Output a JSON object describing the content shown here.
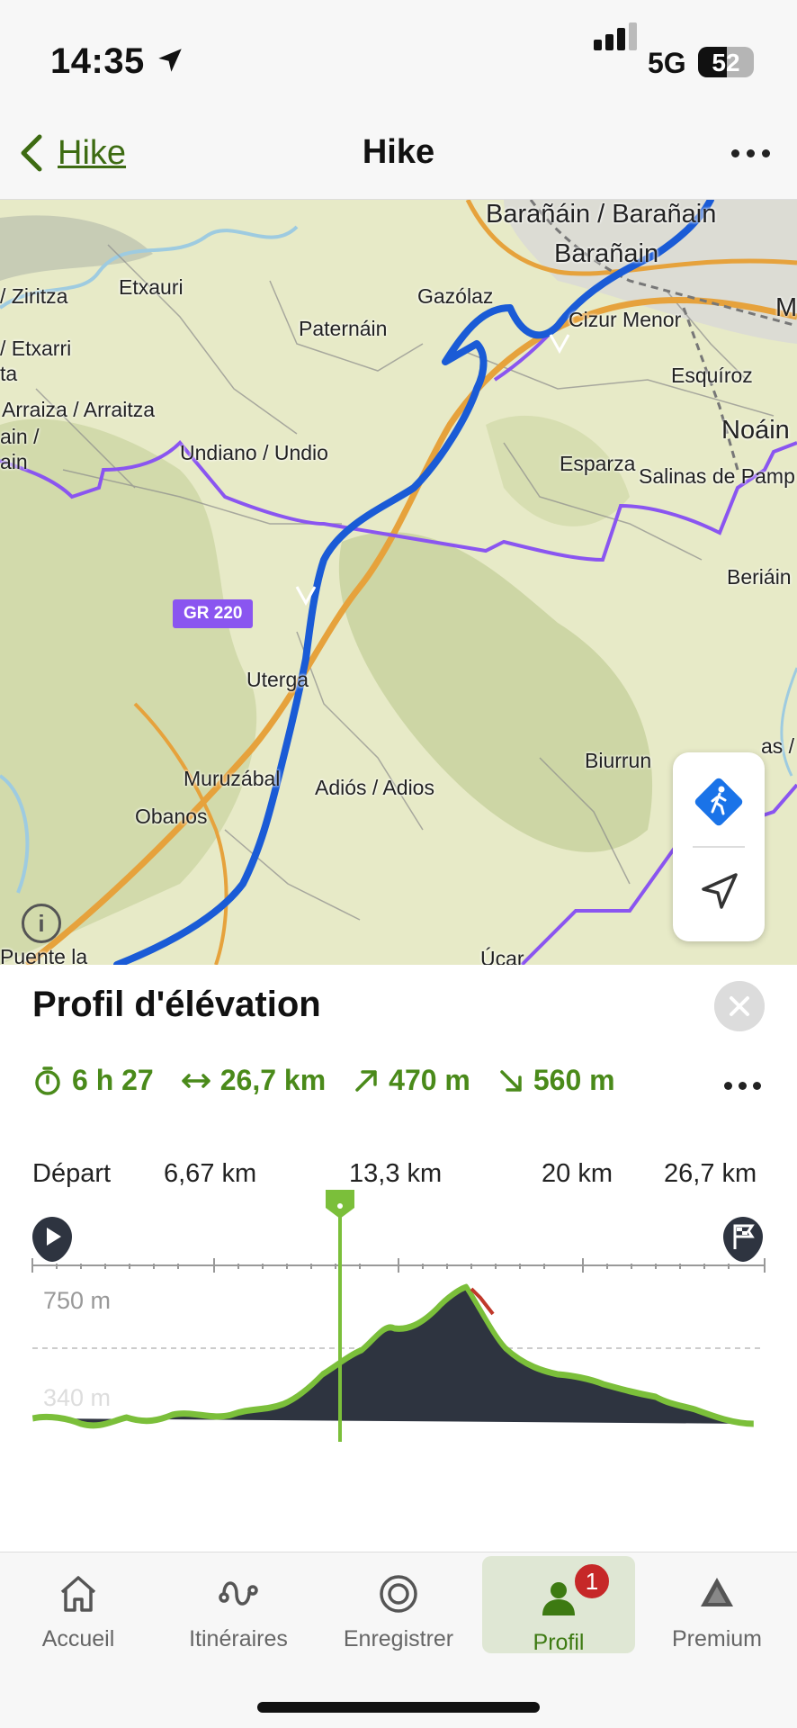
{
  "status": {
    "time": "14:35",
    "network": "5G",
    "battery": "52",
    "battery_level": 0.52
  },
  "nav": {
    "back_label": "Hike",
    "title": "Hike"
  },
  "map": {
    "labels": [
      "Barañáin / Barañain",
      "Barañain",
      "Etxauri",
      "Gazólaz",
      "/ Ziritza",
      "Cizur Menor",
      "Paternáin",
      "/ Etxarri",
      "ta",
      "Esquíroz",
      "Arraiza / Arraitza",
      "Noáin",
      "ain /",
      "ain",
      "Undiano / Undio",
      "Esparza",
      "Salinas de Pamp",
      "Beriáin",
      "Uterga",
      "Biurrun",
      "as /",
      "Muruzábal",
      "Adiós / Adios",
      "Obanos",
      "Puente la",
      "Úcar",
      "M"
    ],
    "trail_badge": "GR 220",
    "info_icon": "info-icon",
    "controls": {
      "activity_icon": "hiker-icon",
      "locate_icon": "navigation-arrow-icon"
    }
  },
  "panel": {
    "title": "Profil d'élévation",
    "stats": {
      "duration": "6 h 27",
      "distance": "26,7 km",
      "ascent": "470 m",
      "descent": "560 m"
    },
    "distance_labels": [
      "Départ",
      "6,67 km",
      "13,3 km",
      "20 km",
      "26,7 km"
    ],
    "elevation_labels": [
      "750 m",
      "340 m"
    ],
    "accent_color": "#7bbf3a"
  },
  "tabs": [
    {
      "label": "Accueil",
      "icon": "home-icon"
    },
    {
      "label": "Itinéraires",
      "icon": "route-icon"
    },
    {
      "label": "Enregistrer",
      "icon": "record-icon"
    },
    {
      "label": "Profil",
      "icon": "profile-icon",
      "badge": "1",
      "active": true
    },
    {
      "label": "Premium",
      "icon": "premium-icon"
    }
  ]
}
